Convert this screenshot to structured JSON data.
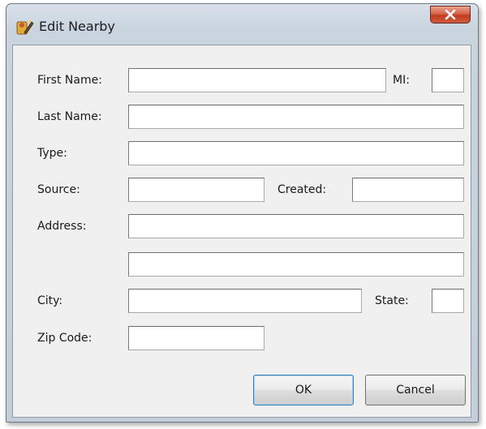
{
  "window": {
    "title": "Edit Nearby",
    "close_symbol": "x"
  },
  "form": {
    "first_name": {
      "label": "First Name:",
      "value": ""
    },
    "mi": {
      "label": "MI:",
      "value": ""
    },
    "last_name": {
      "label": "Last Name:",
      "value": ""
    },
    "type": {
      "label": "Type:",
      "value": ""
    },
    "source": {
      "label": "Source:",
      "value": ""
    },
    "created": {
      "label": "Created:",
      "value": ""
    },
    "address": {
      "label": "Address:",
      "line1": "",
      "line2": ""
    },
    "city": {
      "label": "City:",
      "value": ""
    },
    "state": {
      "label": "State:",
      "value": ""
    },
    "zip_code": {
      "label": "Zip Code:",
      "value": ""
    }
  },
  "buttons": {
    "ok_label": "OK",
    "cancel_label": "Cancel"
  },
  "icons": {
    "title_icon": "edit-app-icon",
    "close_icon": "close-icon"
  }
}
